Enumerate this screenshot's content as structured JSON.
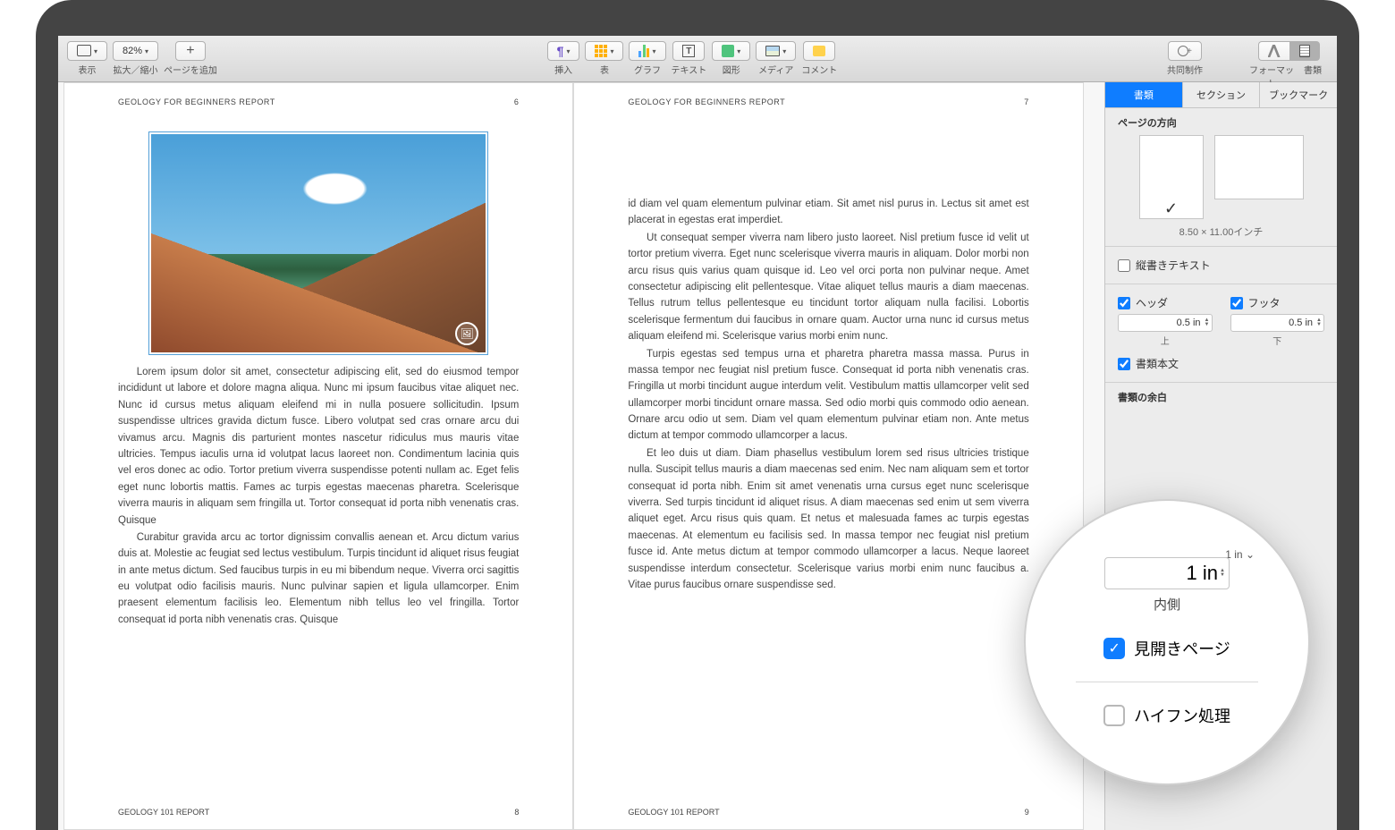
{
  "toolbar": {
    "view_label": "表示",
    "zoom_value": "82%",
    "zoom_label": "拡大／縮小",
    "add_page_label": "ページを追加",
    "insert_label": "挿入",
    "table_label": "表",
    "chart_label": "グラフ",
    "text_label": "テキスト",
    "shape_label": "図形",
    "media_label": "メディア",
    "comment_label": "コメント",
    "collaborate_label": "共同制作",
    "format_label": "フォーマット",
    "document_label": "書類",
    "pilcrow_glyph": "¶"
  },
  "document": {
    "header_text": "GEOLOGY FOR BEGINNERS REPORT",
    "footer_text": "GEOLOGY 101 REPORT",
    "pages": [
      {
        "header_num": "6",
        "footer_num": "8"
      },
      {
        "header_num": "7",
        "footer_num": "9"
      }
    ],
    "left_body": [
      "Lorem ipsum dolor sit amet, consectetur adipiscing elit, sed do eiusmod tempor incididunt ut labore et dolore magna aliqua. Nunc mi ipsum faucibus vitae aliquet nec. Nunc id cursus metus aliquam eleifend mi in nulla posuere sollicitudin. Ipsum suspendisse ultrices gravida dictum fusce. Libero volutpat sed cras ornare arcu dui vivamus arcu. Magnis dis parturient montes nascetur ridiculus mus mauris vitae ultricies. Tempus iaculis urna id volutpat lacus laoreet non. Condimentum lacinia quis vel eros donec ac odio. Tortor pretium viverra suspendisse potenti nullam ac. Eget felis eget nunc lobortis mattis. Fames ac turpis egestas maecenas pharetra. Scelerisque viverra mauris in aliquam sem fringilla ut. Tortor consequat id porta nibh venenatis cras. Quisque",
      "Curabitur gravida arcu ac tortor dignissim convallis aenean et. Arcu dictum varius duis at. Molestie ac feugiat sed lectus vestibulum. Turpis tincidunt id aliquet risus feugiat in ante metus dictum. Sed faucibus turpis in eu mi bibendum neque. Viverra orci sagittis eu volutpat odio facilisis mauris. Nunc pulvinar sapien et ligula ullamcorper. Enim praesent elementum facilisis leo. Elementum nibh tellus leo vel fringilla. Tortor consequat id porta nibh venenatis cras. Quisque"
    ],
    "right_body": [
      "id diam vel quam elementum pulvinar etiam. Sit amet nisl purus in. Lectus sit amet est placerat in egestas erat imperdiet.",
      "Ut consequat semper viverra nam libero justo laoreet. Nisl pretium fusce id velit ut tortor pretium viverra. Eget nunc scelerisque viverra mauris in aliquam. Dolor morbi non arcu risus quis varius quam quisque id. Leo vel orci porta non pulvinar neque. Amet consectetur adipiscing elit pellentesque. Vitae aliquet tellus mauris a diam maecenas. Tellus rutrum tellus pellentesque eu tincidunt tortor aliquam nulla facilisi. Lobortis scelerisque fermentum dui faucibus in ornare quam. Auctor urna nunc id cursus metus aliquam eleifend mi. Scelerisque varius morbi enim nunc.",
      "Turpis egestas sed tempus urna et pharetra pharetra massa massa. Purus in massa tempor nec feugiat nisl pretium fusce. Consequat id porta nibh venenatis cras. Fringilla ut morbi tincidunt augue interdum velit. Vestibulum mattis ullamcorper velit sed ullamcorper morbi tincidunt ornare massa. Sed odio morbi quis commodo odio aenean. Ornare arcu odio ut sem. Diam vel quam elementum pulvinar etiam non. Ante metus dictum at tempor commodo ullamcorper a lacus.",
      "Et leo duis ut diam. Diam phasellus vestibulum lorem sed risus ultricies tristique nulla. Suscipit tellus mauris a diam maecenas sed enim. Nec nam aliquam sem et tortor consequat id porta nibh. Enim sit amet venenatis urna cursus eget nunc scelerisque viverra. Sed turpis tincidunt id aliquet risus. A diam maecenas sed enim ut sem viverra aliquet eget. Arcu risus quis quam. Et netus et malesuada fames ac turpis egestas maecenas. At elementum eu facilisis sed. In massa tempor nec feugiat nisl pretium fusce id. Ante metus dictum at tempor commodo ullamcorper a lacus. Neque laoreet suspendisse interdum consectetur. Scelerisque varius morbi enim nunc faucibus a. Vitae purus faucibus ornare suspendisse sed."
    ],
    "image_badge_glyph": "🖼"
  },
  "inspector": {
    "tabs": {
      "document": "書類",
      "section": "セクション",
      "bookmark": "ブックマーク"
    },
    "orientation_title": "ページの方向",
    "orientation_check": "✓",
    "page_size": "8.50 × 11.00インチ",
    "vertical_text_label": "縦書きテキスト",
    "header_label": "ヘッダ",
    "footer_label": "フッタ",
    "header_value": "0.5 in",
    "footer_value": "0.5 in",
    "top_label": "上",
    "bottom_label": "下",
    "body_label": "書類本文",
    "margins_title": "書類の余白"
  },
  "magnifier": {
    "top_small_value": "1 in",
    "big_value": "1 in",
    "inside_label": "内側",
    "facing_pages_label": "見開きページ",
    "hyphenation_label": "ハイフン処理",
    "check_glyph": "✓",
    "stepper_glyph": "⌄"
  }
}
